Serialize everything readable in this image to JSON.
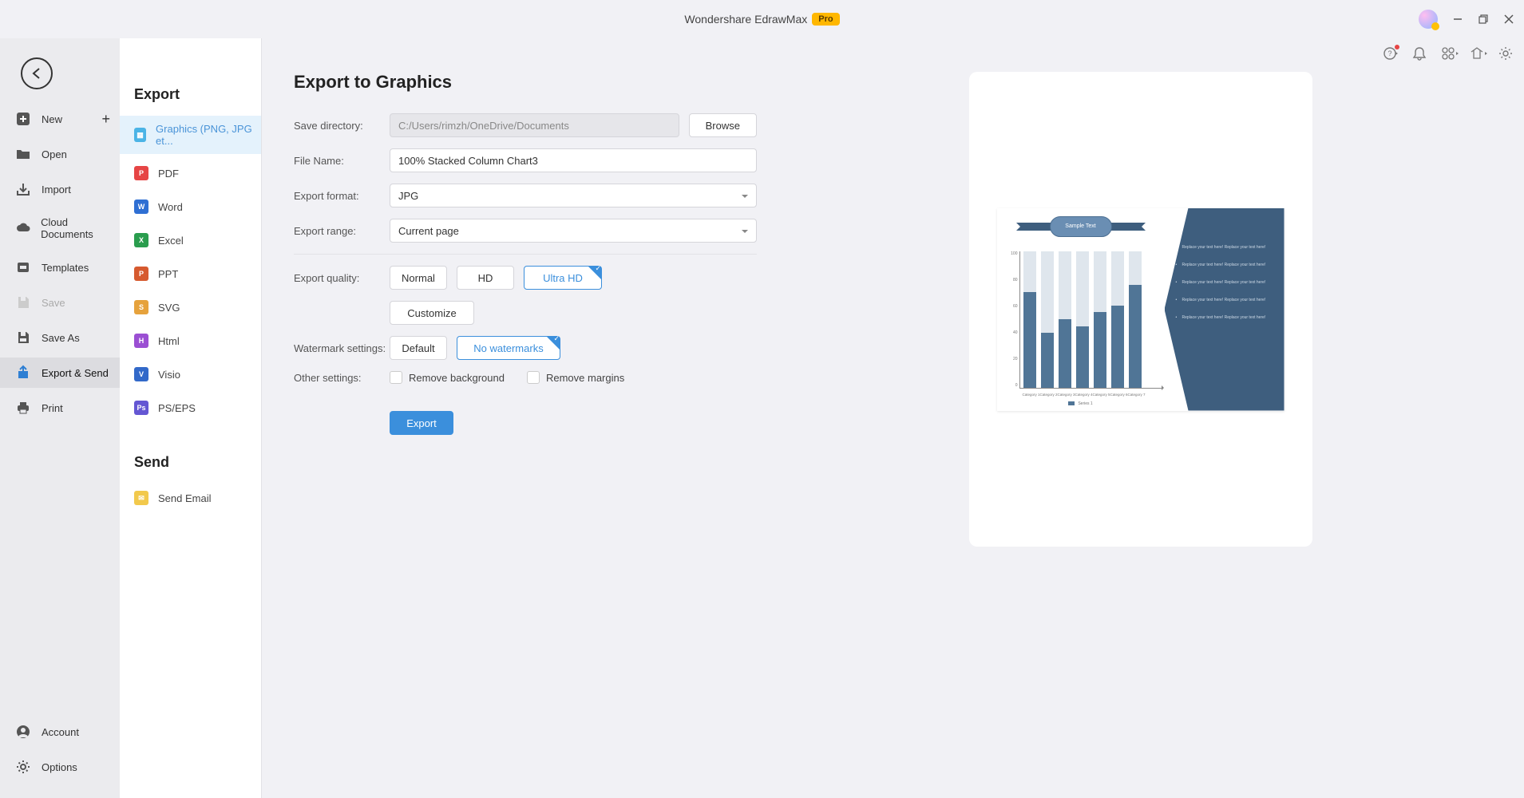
{
  "titlebar": {
    "title": "Wondershare EdrawMax",
    "pro": "Pro"
  },
  "menu1": {
    "new": "New",
    "open": "Open",
    "import": "Import",
    "cloud": "Cloud Documents",
    "templates": "Templates",
    "save": "Save",
    "saveas": "Save As",
    "exportsend": "Export & Send",
    "print": "Print",
    "account": "Account",
    "options": "Options"
  },
  "panel": {
    "export_h": "Export",
    "send_h": "Send",
    "formats": {
      "graphics": "Graphics (PNG, JPG et...",
      "pdf": "PDF",
      "word": "Word",
      "excel": "Excel",
      "ppt": "PPT",
      "svg": "SVG",
      "html": "Html",
      "visio": "Visio",
      "pseps": "PS/EPS"
    },
    "sendmail": "Send Email"
  },
  "form": {
    "heading": "Export to Graphics",
    "savedir_lbl": "Save directory:",
    "savedir_val": "C:/Users/rimzh/OneDrive/Documents",
    "browse": "Browse",
    "filename_lbl": "File Name:",
    "filename_val": "100% Stacked Column Chart3",
    "format_lbl": "Export format:",
    "format_val": "JPG",
    "range_lbl": "Export range:",
    "range_val": "Current page",
    "quality_lbl": "Export quality:",
    "q_normal": "Normal",
    "q_hd": "HD",
    "q_uhd": "Ultra HD",
    "customize": "Customize",
    "wm_lbl": "Watermark settings:",
    "wm_default": "Default",
    "wm_none": "No watermarks",
    "other_lbl": "Other settings:",
    "rm_bg": "Remove background",
    "rm_mg": "Remove margins",
    "export_btn": "Export"
  },
  "preview": {
    "title": "Sample Text",
    "bullet": "Replace your text here! Replace your text here!",
    "legend": "Series 1"
  },
  "chart_data": {
    "type": "bar",
    "title": "Sample Text",
    "categories": [
      "Category 1",
      "Category 2",
      "Category 3",
      "Category 4",
      "Category 5",
      "Category 6",
      "Category 7"
    ],
    "series": [
      {
        "name": "Series 1",
        "values": [
          70,
          40,
          50,
          45,
          55,
          60,
          75
        ]
      }
    ],
    "stack_total": 100,
    "ylim": [
      0,
      100
    ],
    "ytick_count": 6,
    "annotations": [
      "Replace your text here! Replace your text here!",
      "Replace your text here! Replace your text here!",
      "Replace your text here! Replace your text here!",
      "Replace your text here! Replace your text here!",
      "Replace your text here! Replace your text here!"
    ]
  }
}
